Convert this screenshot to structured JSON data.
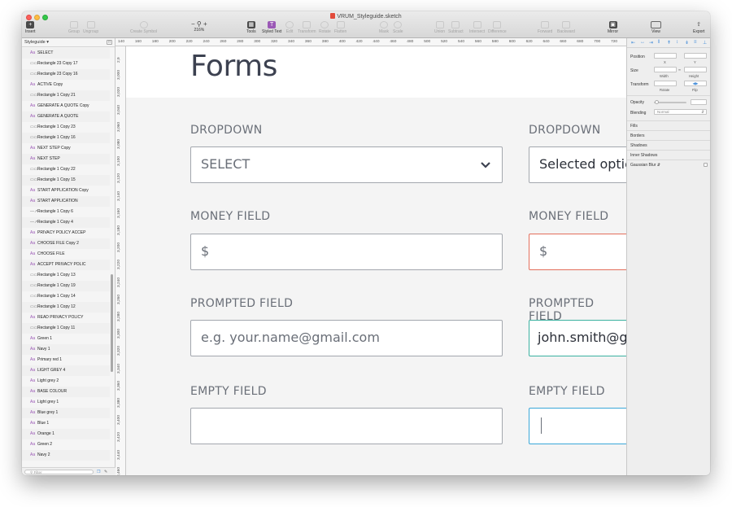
{
  "window": {
    "title": "VRUM_Styleguide.sketch"
  },
  "toolbar": {
    "items": [
      {
        "label": "Insert",
        "icon": "insert-icon"
      },
      {
        "label": "Group",
        "icon": "group-icon"
      },
      {
        "label": "Ungroup",
        "icon": "ungroup-icon"
      },
      {
        "label": "Create Symbol",
        "icon": "symbol-icon"
      },
      {
        "label": "Tools",
        "icon": "tools-icon"
      },
      {
        "label": "Styled Text",
        "icon": "styled-text-icon"
      },
      {
        "label": "Edit",
        "icon": "edit-icon"
      },
      {
        "label": "Transform",
        "icon": "transform-icon"
      },
      {
        "label": "Rotate",
        "icon": "rotate-icon"
      },
      {
        "label": "Flatten",
        "icon": "flatten-icon"
      },
      {
        "label": "Mask",
        "icon": "mask-icon"
      },
      {
        "label": "Scale",
        "icon": "scale-icon"
      },
      {
        "label": "Union",
        "icon": "union-icon"
      },
      {
        "label": "Subtract",
        "icon": "subtract-icon"
      },
      {
        "label": "Intersect",
        "icon": "intersect-icon"
      },
      {
        "label": "Difference",
        "icon": "difference-icon"
      },
      {
        "label": "Forward",
        "icon": "forward-icon"
      },
      {
        "label": "Backward",
        "icon": "backward-icon"
      },
      {
        "label": "Mirror",
        "icon": "mirror-icon"
      },
      {
        "label": "View",
        "icon": "view-icon"
      },
      {
        "label": "Export",
        "icon": "export-icon"
      }
    ],
    "zoom": "216%",
    "zoom_minus": "−",
    "zoom_plus": "+"
  },
  "layers": {
    "page_name": "Styleguide",
    "filter_placeholder": "Filter",
    "items": [
      {
        "type": "text",
        "name": "SELECT"
      },
      {
        "type": "rect",
        "name": "Rectangle 23 Copy 17"
      },
      {
        "type": "rect",
        "name": "Rectangle 23 Copy 16"
      },
      {
        "type": "text",
        "name": "ACTIVE Copy"
      },
      {
        "type": "rect",
        "name": "Rectangle 1 Copy 21"
      },
      {
        "type": "text",
        "name": "GENERATE A QUOTE Copy"
      },
      {
        "type": "text",
        "name": "GENERATE A QUOTE"
      },
      {
        "type": "rect",
        "name": "Rectangle 1 Copy 23"
      },
      {
        "type": "rect",
        "name": "Rectangle 1 Copy 16"
      },
      {
        "type": "text",
        "name": "NEXT STEP Copy"
      },
      {
        "type": "text",
        "name": "NEXT STEP"
      },
      {
        "type": "rect",
        "name": "Rectangle 1 Copy 22"
      },
      {
        "type": "rect",
        "name": "Rectangle 1 Copy 15"
      },
      {
        "type": "text",
        "name": "START APPLICATION Copy"
      },
      {
        "type": "text",
        "name": "START APPLICATION"
      },
      {
        "type": "path",
        "name": "Rectangle 1 Copy 6"
      },
      {
        "type": "path",
        "name": "Rectangle 1 Copy 4"
      },
      {
        "type": "text",
        "name": "PRIVACY POLICY ACCEP"
      },
      {
        "type": "text",
        "name": "CHOOSE FILE Copy 2"
      },
      {
        "type": "text",
        "name": "CHOOSE FILE"
      },
      {
        "type": "text",
        "name": "ACCEPT PRIVACY POLIC"
      },
      {
        "type": "rect",
        "name": "Rectangle 1 Copy 13"
      },
      {
        "type": "rect",
        "name": "Rectangle 1 Copy 19"
      },
      {
        "type": "rect",
        "name": "Rectangle 1 Copy 14"
      },
      {
        "type": "rect",
        "name": "Rectangle 1 Copy 12"
      },
      {
        "type": "text",
        "name": "READ PRIVACY POLICY"
      },
      {
        "type": "rect",
        "name": "Rectangle 1 Copy 11"
      },
      {
        "type": "text",
        "name": "Green 1"
      },
      {
        "type": "text",
        "name": "Navy 1"
      },
      {
        "type": "text",
        "name": "Primary red 1"
      },
      {
        "type": "text",
        "name": "LIGHT GREY 4"
      },
      {
        "type": "text",
        "name": "Light grey 2"
      },
      {
        "type": "text",
        "name": "BASE COLOUR"
      },
      {
        "type": "text",
        "name": "Light grey 1"
      },
      {
        "type": "text",
        "name": "Blue grey 1"
      },
      {
        "type": "text",
        "name": "Blue 1"
      },
      {
        "type": "text",
        "name": "Orange 1"
      },
      {
        "type": "text",
        "name": "Green 2"
      },
      {
        "type": "text",
        "name": "Navy 2"
      }
    ]
  },
  "rulers": {
    "horizontal": [
      "140",
      "160",
      "180",
      "200",
      "220",
      "240",
      "260",
      "280",
      "300",
      "320",
      "340",
      "360",
      "380",
      "400",
      "420",
      "440",
      "460",
      "480",
      "500",
      "520",
      "540",
      "560",
      "580",
      "600",
      "620",
      "640",
      "660",
      "680",
      "700",
      "720"
    ],
    "vertical": [
      "2,9",
      "3,000",
      "3,020",
      "3,040",
      "3,060",
      "3,080",
      "3,100",
      "3,120",
      "3,140",
      "3,160",
      "3,180",
      "3,200",
      "3,220",
      "3,240",
      "3,260",
      "3,280",
      "3,300",
      "3,320",
      "3,340",
      "3,360",
      "3,380",
      "3,400",
      "3,420",
      "3,440",
      "3,460"
    ]
  },
  "canvas": {
    "title": "Forms",
    "left": {
      "dropdown_label": "DROPDOWN",
      "dropdown_value": "SELECT",
      "money_label": "MONEY FIELD",
      "money_value": "$",
      "prompted_label": "PROMPTED FIELD",
      "prompted_placeholder": "e.g. your.name@gmail.com",
      "empty_label": "EMPTY FIELD"
    },
    "right": {
      "dropdown_label": "DROPDOWN",
      "dropdown_value": "Selected optic",
      "money_label": "MONEY FIELD",
      "money_value": "$",
      "prompted_label": "PROMPTED FIELD",
      "prompted_value": "john.smith@gr",
      "empty_label": "EMPTY FIELD"
    },
    "colors": {
      "error_border": "#e36f5c",
      "success_border": "#3bb1a0",
      "active_border": "#3aa7d8",
      "label_text": "#6a6f78",
      "title_text": "#3c4150"
    }
  },
  "inspector": {
    "position_label": "Position",
    "x_label": "X",
    "y_label": "Y",
    "size_label": "Size",
    "width_label": "Width",
    "height_label": "Height",
    "transform_label": "Transform",
    "rotate_label": "Rotate",
    "flip_label": "Flip",
    "opacity_label": "Opacity",
    "blending_label": "Blending",
    "blending_value": "Normal",
    "sections": [
      "Fills",
      "Borders",
      "Shadows",
      "Inner Shadows",
      "Gaussian Blur"
    ]
  }
}
